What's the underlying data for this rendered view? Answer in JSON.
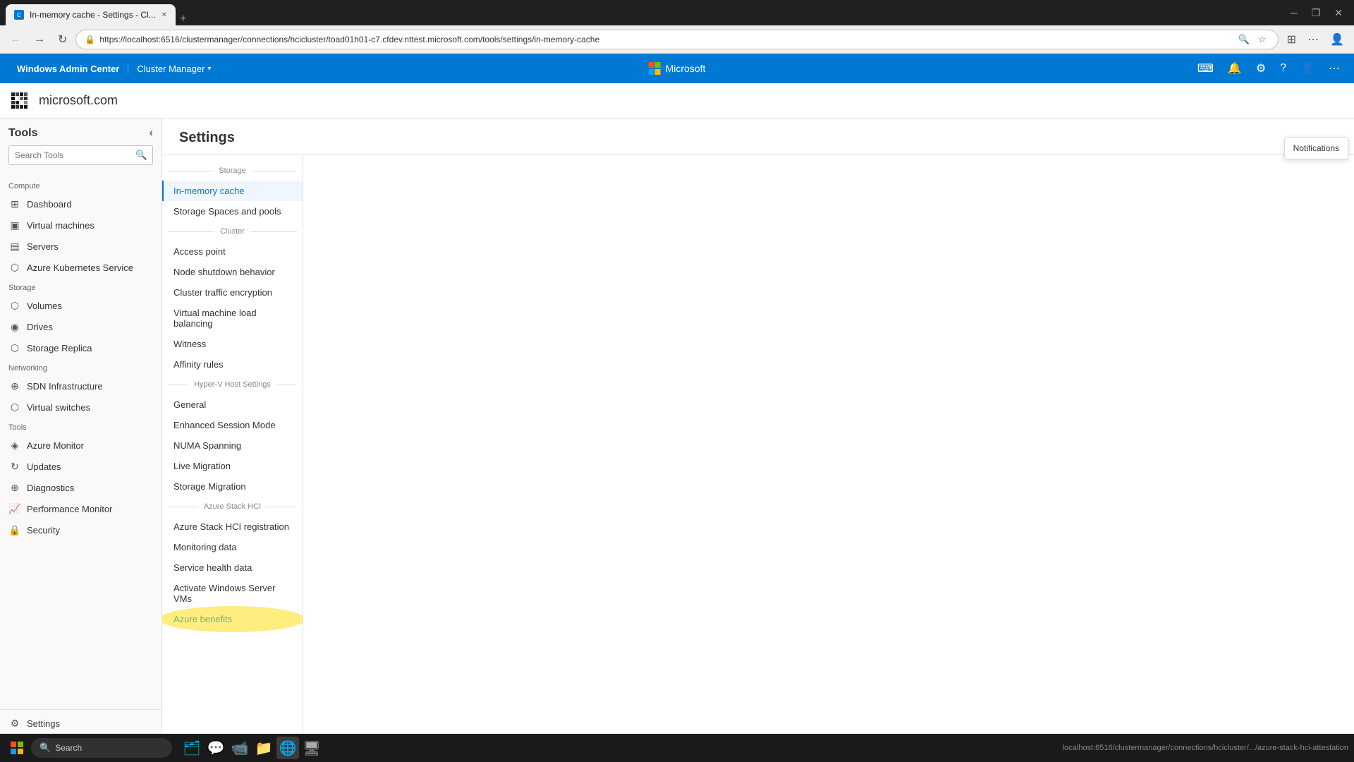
{
  "browser": {
    "tab_title": "In-memory cache - Settings - Cl...",
    "tab_favicon": "C",
    "address": "https://localhost:6516/clustermanager/connections/hcicluster/toad01h01-c7.cfdev.nttest.microsoft.com/tools/settings/in-memory-cache",
    "new_tab_label": "+"
  },
  "wac": {
    "brand": "Windows Admin Center",
    "cluster_manager": "Cluster Manager",
    "ms_label": "Microsoft"
  },
  "domain": {
    "name": "microsoft.com"
  },
  "sidebar": {
    "title": "Tools",
    "search_placeholder": "Search Tools",
    "sections": [
      {
        "label": "Compute",
        "items": [
          {
            "id": "dashboard",
            "label": "Dashboard",
            "icon": "⊞"
          },
          {
            "id": "virtual-machines",
            "label": "Virtual machines",
            "icon": "▣"
          },
          {
            "id": "servers",
            "label": "Servers",
            "icon": "▤"
          },
          {
            "id": "azure-kubernetes",
            "label": "Azure Kubernetes Service",
            "icon": "⬡"
          }
        ]
      },
      {
        "label": "Storage",
        "items": [
          {
            "id": "volumes",
            "label": "Volumes",
            "icon": "⬡"
          },
          {
            "id": "drives",
            "label": "Drives",
            "icon": "◉"
          },
          {
            "id": "storage-replica",
            "label": "Storage Replica",
            "icon": "⬡"
          }
        ]
      },
      {
        "label": "Networking",
        "items": [
          {
            "id": "sdn-infrastructure",
            "label": "SDN Infrastructure",
            "icon": "⊕"
          },
          {
            "id": "virtual-switches",
            "label": "Virtual switches",
            "icon": "⬡"
          }
        ]
      },
      {
        "label": "Tools",
        "items": [
          {
            "id": "azure-monitor",
            "label": "Azure Monitor",
            "icon": "◈"
          },
          {
            "id": "updates",
            "label": "Updates",
            "icon": "↻"
          },
          {
            "id": "diagnostics",
            "label": "Diagnostics",
            "icon": "⊕"
          },
          {
            "id": "performance-monitor",
            "label": "Performance Monitor",
            "icon": "📈"
          },
          {
            "id": "security",
            "label": "Security",
            "icon": "🔒"
          }
        ]
      }
    ],
    "settings_label": "Settings"
  },
  "settings": {
    "title": "Settings",
    "nav": {
      "storage_section": "Storage",
      "cluster_section": "Cluster",
      "hyper_v_section": "Hyper-V Host Settings",
      "azure_stack_section": "Azure Stack HCI",
      "items": [
        {
          "id": "in-memory-cache",
          "label": "In-memory cache",
          "active": true,
          "section": "storage"
        },
        {
          "id": "storage-spaces-and-pools",
          "label": "Storage Spaces and pools",
          "active": false,
          "section": "storage"
        },
        {
          "id": "access-point",
          "label": "Access point",
          "active": false,
          "section": "cluster"
        },
        {
          "id": "node-shutdown-behavior",
          "label": "Node shutdown behavior",
          "active": false,
          "section": "cluster"
        },
        {
          "id": "cluster-traffic-encryption",
          "label": "Cluster traffic encryption",
          "active": false,
          "section": "cluster"
        },
        {
          "id": "virtual-machine-load-balancing",
          "label": "Virtual machine load balancing",
          "active": false,
          "section": "cluster"
        },
        {
          "id": "witness",
          "label": "Witness",
          "active": false,
          "section": "cluster"
        },
        {
          "id": "affinity-rules",
          "label": "Affinity rules",
          "active": false,
          "section": "cluster"
        },
        {
          "id": "general",
          "label": "General",
          "active": false,
          "section": "hyperv"
        },
        {
          "id": "enhanced-session-mode",
          "label": "Enhanced Session Mode",
          "active": false,
          "section": "hyperv"
        },
        {
          "id": "numa-spanning",
          "label": "NUMA Spanning",
          "active": false,
          "section": "hyperv"
        },
        {
          "id": "live-migration",
          "label": "Live Migration",
          "active": false,
          "section": "hyperv"
        },
        {
          "id": "storage-migration",
          "label": "Storage Migration",
          "active": false,
          "section": "hyperv"
        },
        {
          "id": "azure-stack-hci-registration",
          "label": "Azure Stack HCI registration",
          "active": false,
          "section": "azure"
        },
        {
          "id": "monitoring-data",
          "label": "Monitoring data",
          "active": false,
          "section": "azure"
        },
        {
          "id": "service-health-data",
          "label": "Service health data",
          "active": false,
          "section": "azure"
        },
        {
          "id": "activate-windows-server-vms",
          "label": "Activate Windows Server VMs",
          "active": false,
          "section": "azure"
        },
        {
          "id": "azure-benefits",
          "label": "Azure benefits",
          "active": false,
          "section": "azure"
        }
      ]
    }
  },
  "notifications": {
    "label": "Notifications"
  },
  "taskbar": {
    "status_url": "localhost:6516/clustermanager/connections/hcicluster/.../azure-stack-hci-attestation"
  }
}
